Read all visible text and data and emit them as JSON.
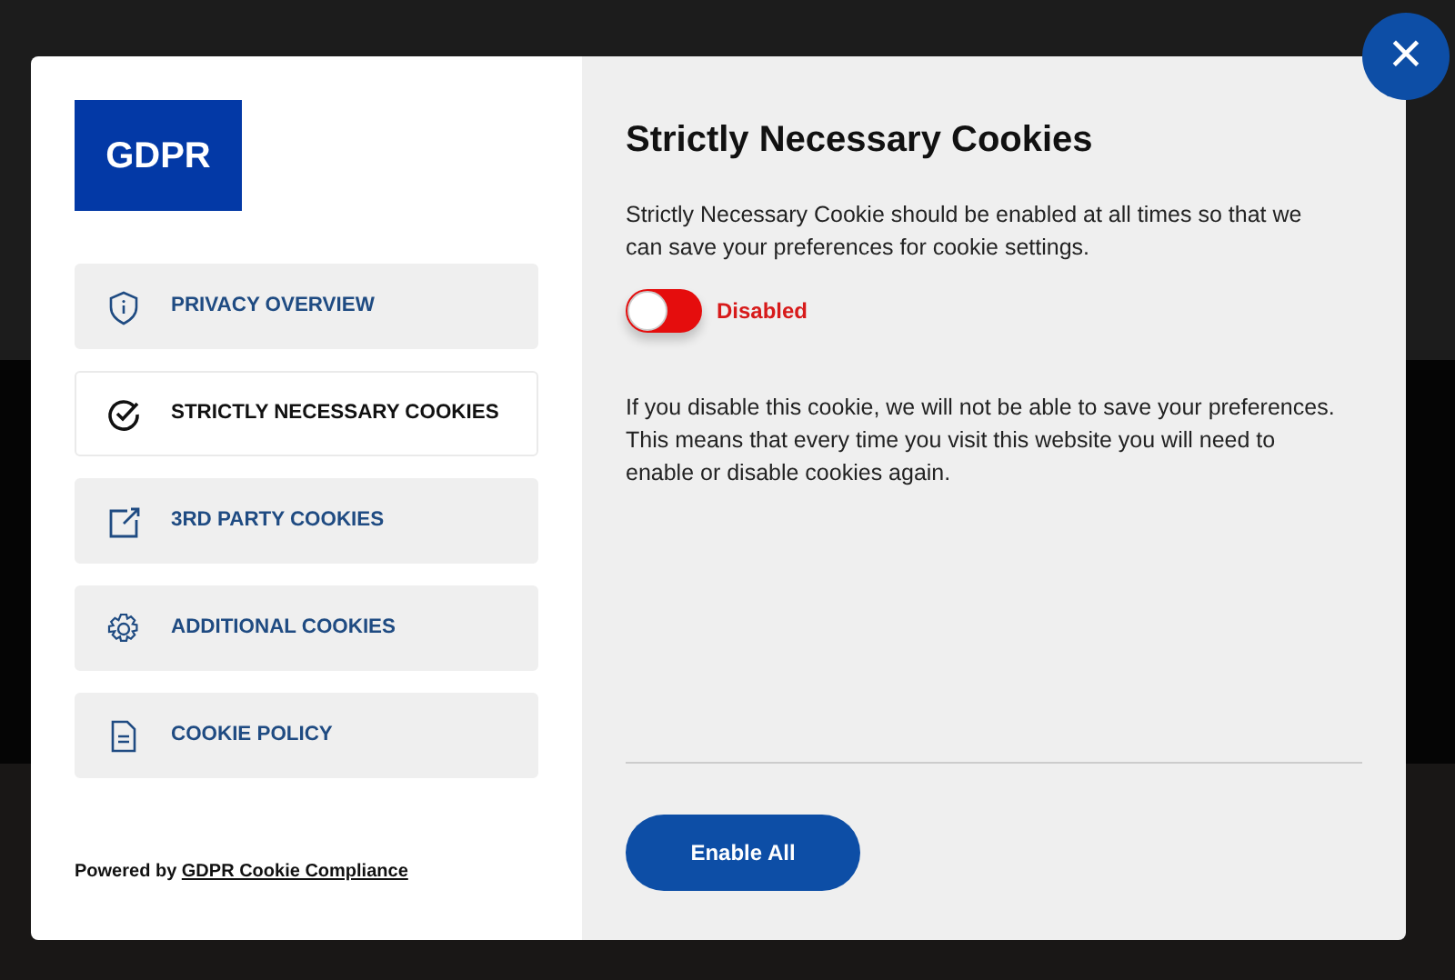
{
  "logo": "GDPR",
  "menu": [
    {
      "label": "PRIVACY OVERVIEW",
      "selected": false
    },
    {
      "label": "STRICTLY NECESSARY COOKIES",
      "selected": true
    },
    {
      "label": "3RD PARTY COOKIES",
      "selected": false
    },
    {
      "label": "ADDITIONAL COOKIES",
      "selected": false
    },
    {
      "label": "COOKIE POLICY",
      "selected": false
    }
  ],
  "powered_by": {
    "text": "Powered by",
    "link": "GDPR Cookie Compliance"
  },
  "content": {
    "title": "Strictly Necessary Cookies",
    "intro": "Strictly Necessary Cookie should be enabled at all times so that we can save your preferences for cookie settings.",
    "toggle": {
      "on": false,
      "label": "Disabled"
    },
    "note": "If you disable this cookie, we will not be able to save your preferences. This means that every time you visit this website you will need to enable or disable cookies again."
  },
  "buttons": [
    "Enable All"
  ],
  "close": "×"
}
